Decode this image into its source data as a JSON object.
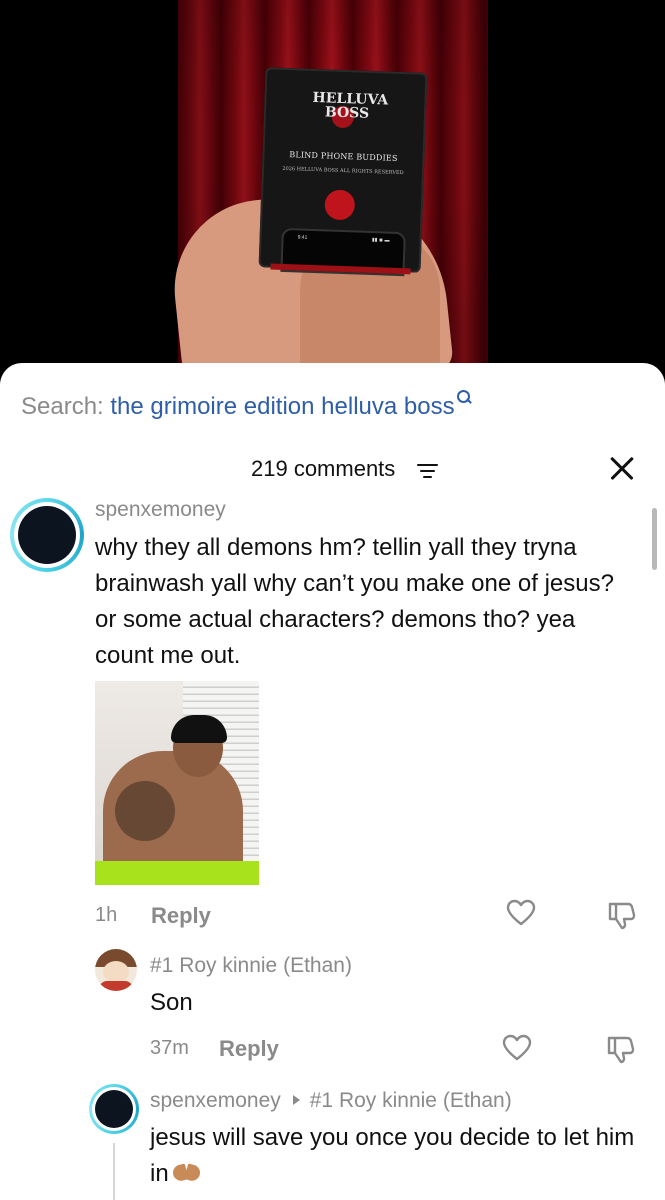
{
  "video": {
    "box_logo": "HELLUVA BOSS",
    "box_title": "BLIND PHONE BUDDIES",
    "box_subtitle": "2026 HELLUVA BOSS ALL RIGHTS RESERVED",
    "box_phone_time": "9:41"
  },
  "search": {
    "label": "Search: ",
    "query": "the grimoire edition helluva boss"
  },
  "comments_header": {
    "count_label": "219 comments"
  },
  "comments": [
    {
      "username": "spenxemoney",
      "text": "why they all demons hm? tellin yall they tryna brainwash yall why can’t you make one of jesus? or some actual characters? demons tho? yea count me out.",
      "time": "1h",
      "reply_label": "Reply"
    }
  ],
  "replies": [
    {
      "username": "#1 Roy kinnie (Ethan)",
      "text": "Son",
      "time": "37m",
      "reply_label": "Reply"
    },
    {
      "username": "spenxemoney",
      "reply_to": "#1 Roy kinnie (Ethan)",
      "text": "jesus will save you once you decide to let him in"
    }
  ],
  "colors": {
    "link_blue": "#2f5ea8",
    "muted_gray": "#8a8a8a",
    "story_ring": "#4ad0e5"
  }
}
